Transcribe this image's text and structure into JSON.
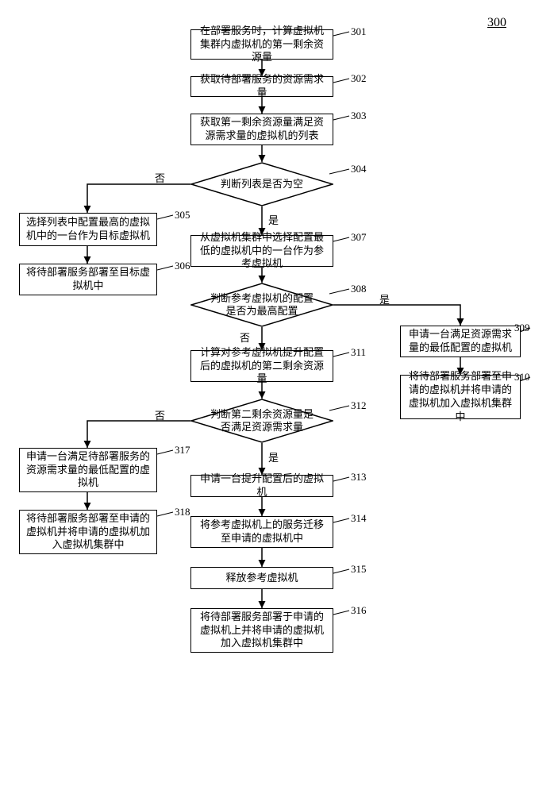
{
  "title": "300",
  "steps": {
    "s301": "在部署服务时，计算虚拟机集群内虚拟机的第一剩余资源量",
    "s302": "获取待部署服务的资源需求量",
    "s303": "获取第一剩余资源量满足资源需求量的虚拟机的列表",
    "s304": "判断列表是否为空",
    "s305": "选择列表中配置最高的虚拟机中的一台作为目标虚拟机",
    "s306": "将待部署服务部署至目标虚拟机中",
    "s307": "从虚拟机集群中选择配置最低的虚拟机中的一台作为参考虚拟机",
    "s308": "判断参考虚拟机的配置是否为最高配置",
    "s309": "申请一台满足资源需求量的最低配置的虚拟机",
    "s310": "将待部署服务部署至申请的虚拟机并将申请的虚拟机加入虚拟机集群中",
    "s311": "计算对参考虚拟机提升配置后的虚拟机的第二剩余资源量",
    "s312": "判断第二剩余资源量是否满足资源需求量",
    "s313": "申请一台提升配置后的虚拟机",
    "s314": "将参考虚拟机上的服务迁移至申请的虚拟机中",
    "s315": "释放参考虚拟机",
    "s316": "将待部署服务部署于申请的虚拟机上并将申请的虚拟机加入虚拟机集群中",
    "s317": "申请一台满足待部署服务的资源需求量的最低配置的虚拟机",
    "s318": "将待部署服务部署至申请的虚拟机并将申请的虚拟机加入虚拟机集群中"
  },
  "nums": {
    "n301": "301",
    "n302": "302",
    "n303": "303",
    "n304": "304",
    "n305": "305",
    "n306": "306",
    "n307": "307",
    "n308": "308",
    "n309": "309",
    "n310": "310",
    "n311": "311",
    "n312": "312",
    "n313": "313",
    "n314": "314",
    "n315": "315",
    "n316": "316",
    "n317": "317",
    "n318": "318"
  },
  "labels": {
    "no1": "否",
    "yes1": "是",
    "yes2": "是",
    "no2": "否",
    "no3": "否",
    "yes3": "是"
  }
}
